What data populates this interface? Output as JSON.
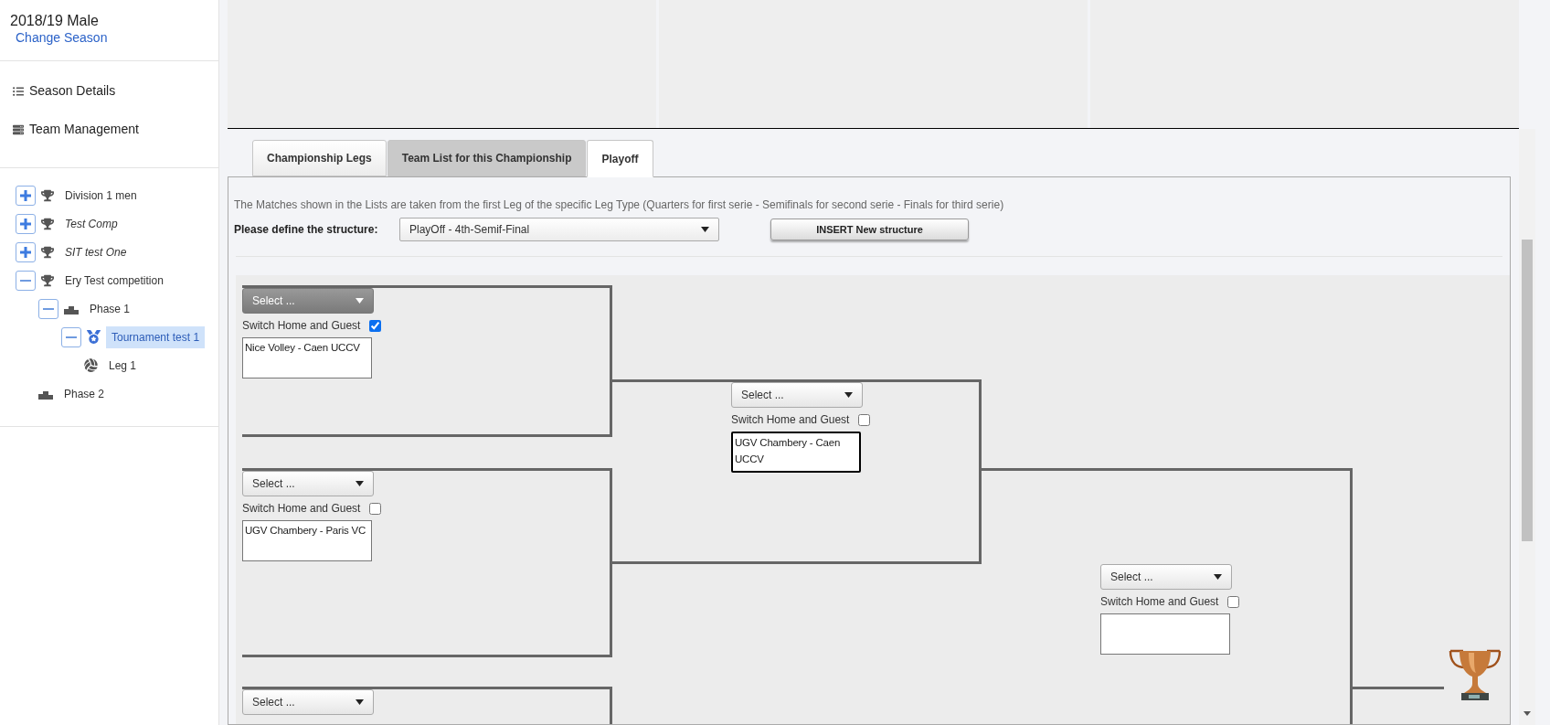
{
  "sidebar": {
    "season": "2018/19 Male",
    "change_link": "Change Season",
    "menu": [
      {
        "kind": "list",
        "label": "Season Details"
      },
      {
        "kind": "rows",
        "label": "Team Management"
      }
    ],
    "tree": [
      {
        "label": "Division 1 men",
        "kind": "trophy",
        "italic": false,
        "expanded": false,
        "selected": false
      },
      {
        "label": "Test Comp",
        "kind": "trophy",
        "italic": true,
        "expanded": false,
        "selected": false
      },
      {
        "label": "SIT test One",
        "kind": "trophy",
        "italic": true,
        "expanded": false,
        "selected": false
      },
      {
        "label": "Ery Test competition",
        "kind": "trophy",
        "italic": false,
        "expanded": true,
        "selected": false,
        "children": [
          {
            "label": "Phase 1",
            "kind": "podium",
            "italic": false,
            "expanded": true,
            "selected": false,
            "children": [
              {
                "label": "Tournament test 1",
                "kind": "medal",
                "italic": false,
                "expanded": true,
                "selected": true,
                "children": [
                  {
                    "label": "Leg 1",
                    "kind": "ball",
                    "italic": false,
                    "selected": false
                  }
                ]
              }
            ]
          },
          {
            "label": "Phase 2",
            "kind": "podium",
            "italic": false,
            "selected": false
          }
        ]
      }
    ]
  },
  "tabs": [
    {
      "label": "Championship Legs",
      "selected": false,
      "highlighted": false
    },
    {
      "label": "Team List for this Championship",
      "selected": false,
      "highlighted": true
    },
    {
      "label": "Playoff",
      "selected": true,
      "highlighted": false
    }
  ],
  "playoff": {
    "note": "The Matches shown in the Lists are taken from the first Leg of the specific Leg Type (Quarters for first serie - Semifinals for second serie - Finals for third serie)",
    "structure_label": "Please define the structure:",
    "structure_value": "PlayOff - 4th-Semif-Final",
    "insert_button": "INSERT New structure",
    "rounds": [
      {
        "matches": [
          {
            "select": "Select ...",
            "select_active": true,
            "switch_label": "Switch Home and Guest",
            "switch_checked": true,
            "teams": "Nice Volley - Caen UCCV",
            "teams_focused": false
          },
          {
            "select": "Select ...",
            "select_active": false,
            "switch_label": "Switch Home and Guest",
            "switch_checked": false,
            "teams": "UGV Chambery - Paris VC",
            "teams_focused": false
          },
          {
            "select": "Select ...",
            "select_active": false
          }
        ]
      },
      {
        "matches": [
          {
            "select": "Select ...",
            "select_active": false,
            "switch_label": "Switch Home and Guest",
            "switch_checked": false,
            "teams": "UGV Chambery - Caen UCCV",
            "teams_focused": true
          }
        ]
      },
      {
        "matches": [
          {
            "select": "Select ...",
            "select_active": false,
            "switch_label": "Switch Home and Guest",
            "switch_checked": false
          }
        ]
      }
    ]
  }
}
